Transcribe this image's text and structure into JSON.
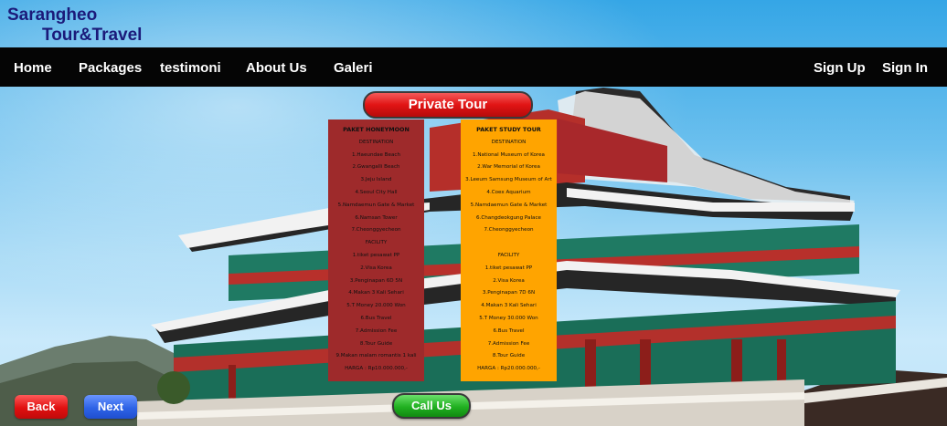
{
  "brand": {
    "line1": "Sarangheo",
    "line2": "Tour&Travel"
  },
  "nav": {
    "home": "Home",
    "packages": "Packages",
    "testimoni": "testimoni",
    "about": "About Us",
    "galeri": "Galeri",
    "signup": "Sign Up",
    "signin": "Sign In"
  },
  "private_tour_label": "Private Tour",
  "honeymoon": {
    "title": "PAKET HONEYMOON",
    "destination_label": "DESTINATION",
    "destinations": [
      "1.Haeundae Beach",
      "2.Gwangalli Beach",
      "3.Jeju Island",
      "4.Seoul City Hall",
      "5.Namdaemun Gate & Market",
      "6.Namsan Tower",
      "7.Cheonggyecheon"
    ],
    "facility_label": "FACILITY",
    "facilities": [
      "1.tiket pesawat PP",
      "2.Visa Korea",
      "3.Penginapan 6D 5N",
      "4.Makan 3 Kali Sehari",
      "5.T Money 20.000 Won",
      "6.Bus Travel",
      "7.Admission Fee",
      "8.Tour Guide",
      "9.Makan malam romantis 1 kali"
    ],
    "price": "HARGA : Rp10.000.000,-"
  },
  "study": {
    "title": "PAKET STUDY TOUR",
    "destination_label": "DESTINATION",
    "destinations": [
      "1.National Museum of Korea",
      "2.War Memorial of Korea",
      "3.Leeum Samsung Museum of Art",
      "4.Coex Aquarium",
      "5.Namdaemun Gate & Market",
      "6.Changdeokgung Palace",
      "7.Cheonggyecheon"
    ],
    "facility_label": "FACILITY",
    "facilities": [
      "1.tiket pesawat PP",
      "2.Visa Korea",
      "3.Penginapan 7D 6N",
      "4.Makan 3 Kali Sehari",
      "5.T Money 30.000 Won",
      "6.Bus Travel",
      "7.Admission Fee",
      "8.Tour Guide"
    ],
    "price": "HARGA : Rp20.000.000,-"
  },
  "buttons": {
    "back": "Back",
    "next": "Next",
    "call": "Call Us"
  },
  "colors": {
    "navbar": "#050505",
    "brand_text": "#1b1a7a",
    "honeymoon_panel": "#9e2a2b",
    "study_panel": "#ffa400",
    "private_tour_button": "#e11414",
    "back_button": "#e01010",
    "next_button": "#2e63e6",
    "call_button": "#20b020"
  }
}
